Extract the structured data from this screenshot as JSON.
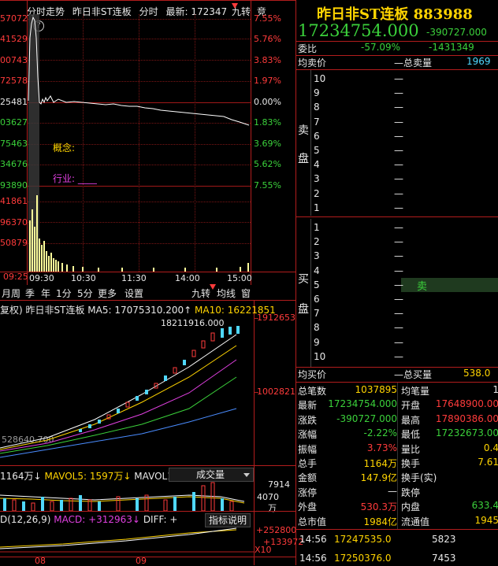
{
  "top_tabs": {
    "t1": "分时走势",
    "t2": "昨日非ST连板",
    "t3": "分时",
    "t4": "最新: 172347",
    "t5": "九转",
    "t6": "竞"
  },
  "left_prices": [
    "57072",
    "41529",
    "00743",
    "72578",
    "25481",
    "03627",
    "75463",
    "34676",
    "93890",
    "41861",
    "96370",
    "50879",
    "09:25"
  ],
  "pct_labels": [
    "7.55%",
    "5.76%",
    "3.83%",
    "1.97%",
    "0.00%",
    "1.83%",
    "3.69%",
    "5.62%",
    "7.55%"
  ],
  "concept_label": "概念:",
  "industry_label": "行业: ____",
  "time_ticks": [
    "09:30",
    "10:30",
    "11:30",
    "14:00",
    "15:00"
  ],
  "toolbar": [
    "月",
    "周",
    "季",
    "年",
    "1分",
    "5分",
    "更多",
    "设置"
  ],
  "toolbar_right": [
    "九转",
    "均线",
    "窗"
  ],
  "kline_info": {
    "prefix": "复权)",
    "name": "昨日非ST连板",
    "ma5": "MA5: 17075310.200↑",
    "ma10": "MA10: 16221851"
  },
  "kline_price_right": [
    "1912653",
    "1002821"
  ],
  "kline_high": "18211916.000",
  "kline_low": "528640.700",
  "vol_info": {
    "v": "1164万↓",
    "mavol5": "MAVOL5: 1597万↓",
    "mavol10": "MAVOL10: 3"
  },
  "vol_select": "成交量",
  "vol_right": [
    "7914",
    "4070",
    "万"
  ],
  "macd_info": {
    "prefix": "D(12,26,9)",
    "macd": "MACD: +312963↓",
    "diff": "DIFF: +"
  },
  "macd_button": "指标说明",
  "macd_right": [
    "+252800",
    "+133972",
    "X10"
  ],
  "bottom_months": [
    "08",
    "09"
  ],
  "quote": {
    "title": "昨日非ST连板 883988",
    "price": "17234754.000",
    "change": "-390727.000",
    "weibi_label": "委比",
    "weibi": "-57.09%",
    "weicha": "-1431349",
    "sell_header": [
      "均卖价",
      "—总卖量",
      "1969"
    ],
    "buy_header": [
      "均买价",
      "—总买量",
      "538.0"
    ],
    "sell_levels": [
      "10",
      "9",
      "8",
      "7",
      "6",
      "5",
      "4",
      "3",
      "2",
      "1"
    ],
    "buy_levels": [
      "1",
      "2",
      "3",
      "4",
      "5",
      "6",
      "7",
      "8",
      "9",
      "10"
    ],
    "sell_side": [
      "卖",
      "盘"
    ],
    "buy_side": [
      "买",
      "盘"
    ],
    "sell_tag": "卖",
    "dash": "—",
    "stats": [
      [
        "总笔数",
        "1037895",
        "均笔量",
        "1"
      ],
      [
        "最新",
        "17234754.000",
        "开盘",
        "17648900.00"
      ],
      [
        "涨跌",
        "-390727.000",
        "最高",
        "17890386.00"
      ],
      [
        "涨幅",
        "-2.22%",
        "最低",
        "17232673.00"
      ],
      [
        "振幅",
        "3.73%",
        "量比",
        "0.4"
      ],
      [
        "总手",
        "1164万",
        "换手",
        "7.61"
      ],
      [
        "金额",
        "147.9亿",
        "换手(实)",
        ""
      ],
      [
        "涨停",
        "—",
        "跌停",
        ""
      ],
      [
        "外盘",
        "530.3万",
        "内盘",
        "633.4"
      ],
      [
        "总市值",
        "1984亿",
        "流通值",
        "1945"
      ]
    ],
    "ticks": [
      [
        "14:56",
        "17247535.0",
        "5823"
      ],
      [
        "14:56",
        "17250376.0",
        "7453"
      ]
    ]
  },
  "colors": {
    "up": "#ff3b3b",
    "down": "#3bd13b",
    "axis": "#b21d1d",
    "bg": "#000000"
  }
}
